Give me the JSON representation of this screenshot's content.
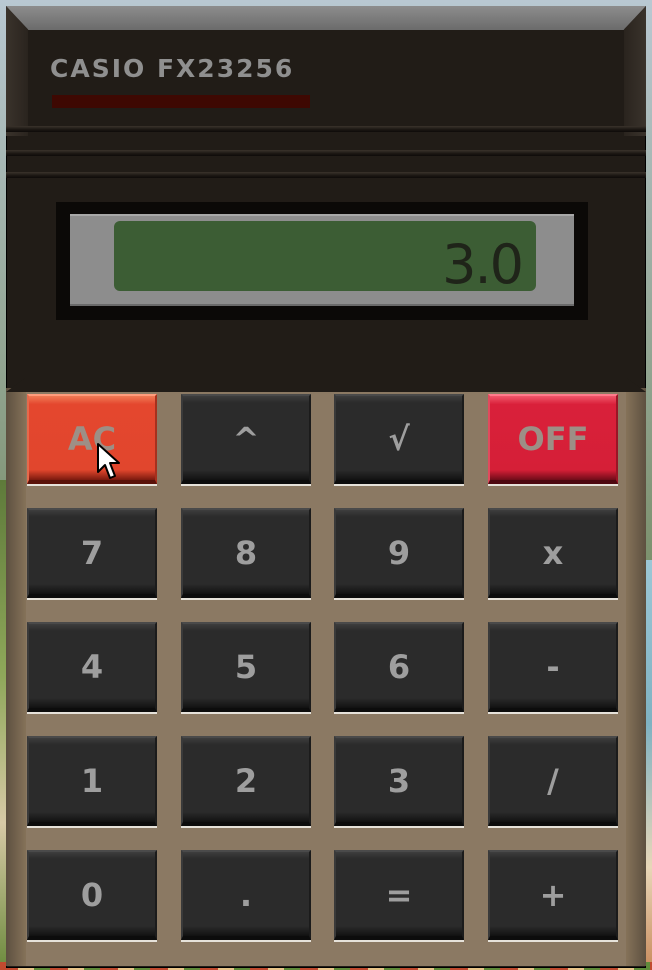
{
  "calculator": {
    "brand": "CASIO FX23256",
    "display": {
      "value": "3.0"
    }
  },
  "keys": [
    {
      "label": "AC",
      "name": "all-clear-button"
    },
    {
      "label": "^",
      "name": "power-button"
    },
    {
      "label": "√",
      "name": "square-root-button"
    },
    {
      "label": "OFF",
      "name": "off-button"
    },
    {
      "label": "7",
      "name": "digit-7-button"
    },
    {
      "label": "8",
      "name": "digit-8-button"
    },
    {
      "label": "9",
      "name": "digit-9-button"
    },
    {
      "label": "x",
      "name": "multiply-button"
    },
    {
      "label": "4",
      "name": "digit-4-button"
    },
    {
      "label": "5",
      "name": "digit-5-button"
    },
    {
      "label": "6",
      "name": "digit-6-button"
    },
    {
      "label": "-",
      "name": "subtract-button"
    },
    {
      "label": "1",
      "name": "digit-1-button"
    },
    {
      "label": "2",
      "name": "digit-2-button"
    },
    {
      "label": "3",
      "name": "digit-3-button"
    },
    {
      "label": "/",
      "name": "divide-button"
    },
    {
      "label": "0",
      "name": "digit-0-button"
    },
    {
      "label": ".",
      "name": "decimal-point-button"
    },
    {
      "label": "=",
      "name": "equals-button"
    },
    {
      "label": "+",
      "name": "add-button"
    }
  ],
  "colors": {
    "body": "#211c17",
    "keypad": "#8b7963",
    "lcd": "#3c5d34",
    "key": "#2b2b2b",
    "ac_key": "#e1462d",
    "off_key": "#d51f37"
  }
}
